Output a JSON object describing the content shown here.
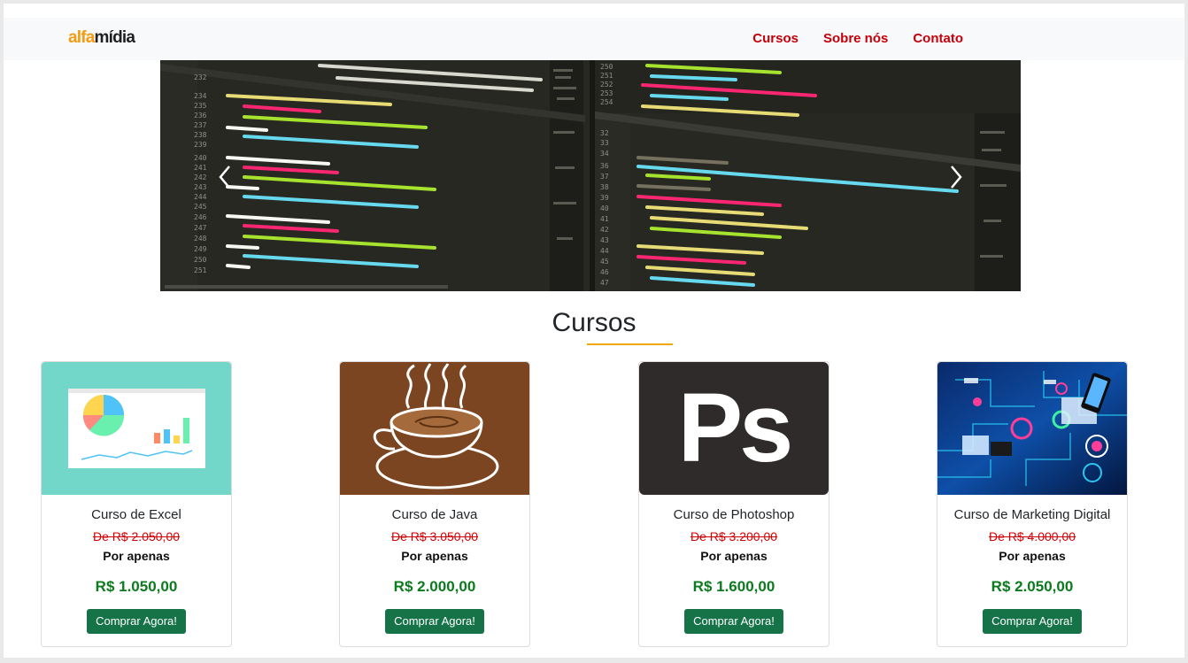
{
  "navbar": {
    "brand_part1": "alfa",
    "brand_part2": "mídia",
    "links": [
      "Cursos",
      "Sobre nós",
      "Contato"
    ]
  },
  "carousel": {
    "prev_icon": "chevron-left-icon",
    "next_icon": "chevron-right-icon"
  },
  "section": {
    "title": "Cursos"
  },
  "cards": [
    {
      "title": "Curso de Excel",
      "old_price": "De R$ 2.050,00",
      "por": "Por apenas",
      "price": "R$ 1.050,00",
      "button": "Comprar Agora!"
    },
    {
      "title": "Curso de Java",
      "old_price": "De R$ 3.050,00",
      "por": "Por apenas",
      "price": "R$ 2.000,00",
      "button": "Comprar Agora!"
    },
    {
      "title": "Curso de Photoshop",
      "old_price": "De R$ 3.200,00",
      "por": "Por apenas",
      "price": "R$ 1.600,00",
      "button": "Comprar Agora!"
    },
    {
      "title": "Curso de Marketing Digital",
      "old_price": "De R$ 4.000,00",
      "por": "Por apenas",
      "price": "R$ 2.050,00",
      "button": "Comprar Agora!"
    }
  ],
  "colors": {
    "nav_link": "#c5000b",
    "brand_accent": "#f39c12",
    "old_price": "#d40000",
    "new_price": "#0c7a1e",
    "button": "#157347",
    "underline": "#f0a800"
  }
}
